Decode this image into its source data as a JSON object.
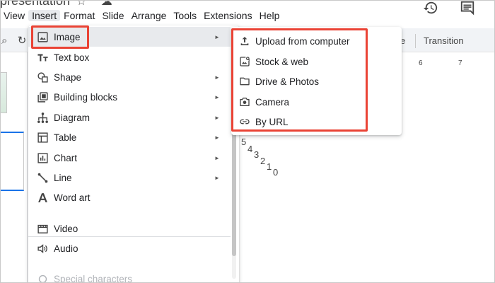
{
  "app": {
    "doc_title": "presentation"
  },
  "menubar": {
    "items": [
      {
        "label": "View"
      },
      {
        "label": "Insert"
      },
      {
        "label": "Format"
      },
      {
        "label": "Slide"
      },
      {
        "label": "Arrange"
      },
      {
        "label": "Tools"
      },
      {
        "label": "Extensions"
      },
      {
        "label": "Help"
      }
    ],
    "active_index": 1
  },
  "toolbar": {
    "partial_text": "e",
    "transition_label": "Transition"
  },
  "ruler": {
    "marks": [
      "6",
      "7"
    ]
  },
  "insert_menu": {
    "items": [
      {
        "icon": "image-icon",
        "label": "Image",
        "has_submenu": true
      },
      {
        "icon": "text-box-icon",
        "label": "Text box",
        "has_submenu": false
      },
      {
        "icon": "shape-icon",
        "label": "Shape",
        "has_submenu": true
      },
      {
        "icon": "building-blocks-icon",
        "label": "Building blocks",
        "has_submenu": true
      },
      {
        "icon": "diagram-icon",
        "label": "Diagram",
        "has_submenu": true
      },
      {
        "icon": "table-icon",
        "label": "Table",
        "has_submenu": true
      },
      {
        "icon": "chart-icon",
        "label": "Chart",
        "has_submenu": true
      },
      {
        "icon": "line-icon",
        "label": "Line",
        "has_submenu": true
      },
      {
        "icon": "word-art-icon",
        "label": "Word art",
        "has_submenu": false
      },
      {
        "icon": "video-icon",
        "label": "Video",
        "has_submenu": false
      },
      {
        "icon": "audio-icon",
        "label": "Audio",
        "has_submenu": false
      },
      {
        "icon": "special-characters-icon",
        "label": "Special characters",
        "has_submenu": false
      }
    ],
    "submenu_arrow": "►"
  },
  "image_submenu": {
    "items": [
      {
        "icon": "upload-icon",
        "label": "Upload from computer"
      },
      {
        "icon": "stock-web-icon",
        "label": "Stock & web"
      },
      {
        "icon": "folder-icon",
        "label": "Drive & Photos"
      },
      {
        "icon": "camera-icon",
        "label": "Camera"
      },
      {
        "icon": "link-icon",
        "label": "By URL"
      }
    ]
  },
  "canvas": {
    "countdown": [
      "5",
      "4",
      "3",
      "2",
      "1",
      "0"
    ]
  },
  "colors": {
    "highlight": "#ea4335",
    "hover": "#e8eaed",
    "accent": "#1a73e8"
  }
}
